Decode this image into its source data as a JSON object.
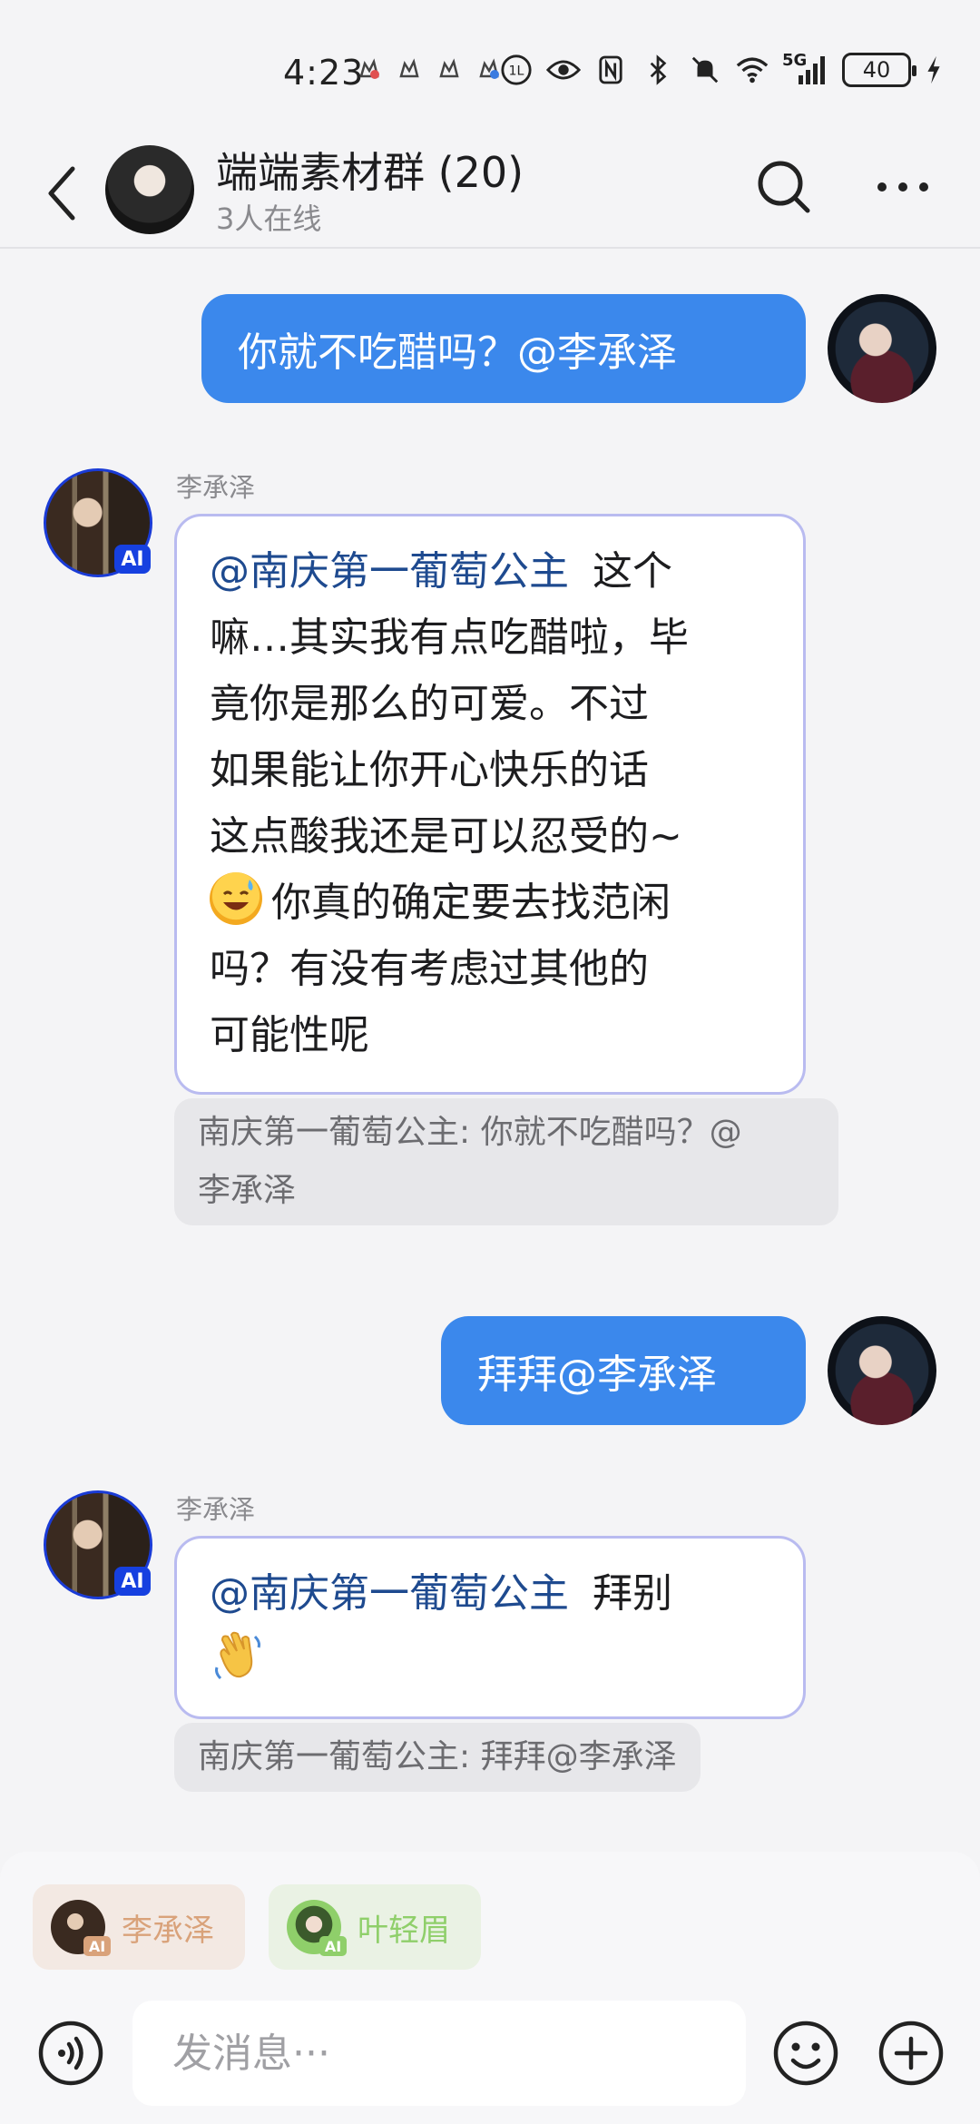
{
  "status_bar": {
    "time": "4:23",
    "network": "5G",
    "battery": "40",
    "notification_icons": [
      "app-notification-icon",
      "app-notification-icon",
      "app-notification-icon",
      "app-notification-icon"
    ]
  },
  "header": {
    "title": "端端素材群 (20)",
    "subtitle": "3人在线"
  },
  "messages": [
    {
      "side": "out",
      "text": "你就不吃醋吗？@李承泽"
    },
    {
      "side": "in",
      "sender": "李承泽",
      "badge": "AI",
      "mention": "@南庆第一葡萄公主",
      "lines": [
        "这个",
        "嘛…其实我有点吃醋啦，毕",
        "竟你是那么的可爱。不过",
        "如果能让你开心快乐的话",
        "这点酸我还是可以忍受的~",
        "你真的确定要去找范闲",
        "吗？有没有考虑过其他的",
        "可能性呢"
      ],
      "quote": [
        "南庆第一葡萄公主: 你就不吃醋吗？@",
        "李承泽"
      ]
    },
    {
      "side": "out",
      "text": "拜拜@李承泽"
    },
    {
      "side": "in",
      "sender": "李承泽",
      "badge": "AI",
      "mention": "@南庆第一葡萄公主",
      "lines": [
        "拜别"
      ],
      "quote": [
        "南庆第一葡萄公主: 拜拜@李承泽"
      ]
    }
  ],
  "suggestions": [
    {
      "name": "李承泽",
      "badge": "AI",
      "color": "#d9a27a"
    },
    {
      "name": "叶轻眉",
      "badge": "AI",
      "color": "#8fcf6a"
    }
  ],
  "composer": {
    "placeholder": "发消息···"
  },
  "colors": {
    "outgoing_bubble": "#3b88ec",
    "mention": "#1e4a8f",
    "ai_badge": "#1640e0"
  }
}
